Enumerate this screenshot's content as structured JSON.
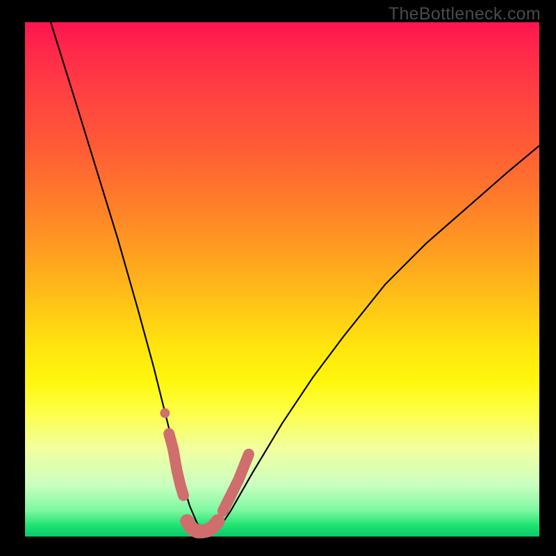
{
  "watermark": "TheBottleneck.com",
  "chart_data": {
    "type": "line",
    "title": "",
    "xlabel": "",
    "ylabel": "",
    "xlim": [
      0,
      100
    ],
    "ylim": [
      0,
      100
    ],
    "grid": false,
    "series": [
      {
        "name": "bottleneck-curve",
        "color": "#000000",
        "x": [
          5,
          10,
          14,
          18,
          22,
          25,
          27,
          29,
          30.5,
          32,
          33.5,
          35,
          36.5,
          38,
          40,
          44,
          50,
          56,
          62,
          70,
          78,
          86,
          94,
          100
        ],
        "values": [
          100,
          84,
          71,
          58,
          44,
          33,
          25,
          17,
          11,
          6,
          2.5,
          1,
          1,
          2,
          5,
          12,
          22,
          31,
          39,
          49,
          57,
          64,
          71,
          76
        ]
      },
      {
        "name": "highlight-left",
        "color": "#cf6e6d",
        "x": [
          28,
          28.8,
          29.5,
          30.2,
          30.8
        ],
        "values": [
          20,
          17,
          13,
          10,
          8
        ]
      },
      {
        "name": "highlight-dot-left",
        "color": "#cf6e6d",
        "x": [
          27.2
        ],
        "values": [
          24
        ]
      },
      {
        "name": "highlight-valley",
        "color": "#cf6e6d",
        "x": [
          31.5,
          32.5,
          33.5,
          34.5,
          35.5,
          36.5,
          37.5
        ],
        "values": [
          3,
          1.5,
          1,
          1,
          1.2,
          1.8,
          3
        ]
      },
      {
        "name": "highlight-right",
        "color": "#cf6e6d",
        "x": [
          38.5,
          39.5,
          40.5,
          41.5,
          42.5,
          43.5
        ],
        "values": [
          5,
          7,
          9,
          11,
          13.5,
          16
        ]
      }
    ],
    "background_gradient": {
      "orientation": "vertical",
      "stops": [
        {
          "offset": 0.0,
          "color": "#ff1450"
        },
        {
          "offset": 0.14,
          "color": "#ff4141"
        },
        {
          "offset": 0.34,
          "color": "#ff7a2b"
        },
        {
          "offset": 0.56,
          "color": "#ffc915"
        },
        {
          "offset": 0.7,
          "color": "#fff70e"
        },
        {
          "offset": 0.83,
          "color": "#f1ffa0"
        },
        {
          "offset": 0.95,
          "color": "#7cf7a0"
        },
        {
          "offset": 1.0,
          "color": "#0cc96c"
        }
      ]
    }
  }
}
